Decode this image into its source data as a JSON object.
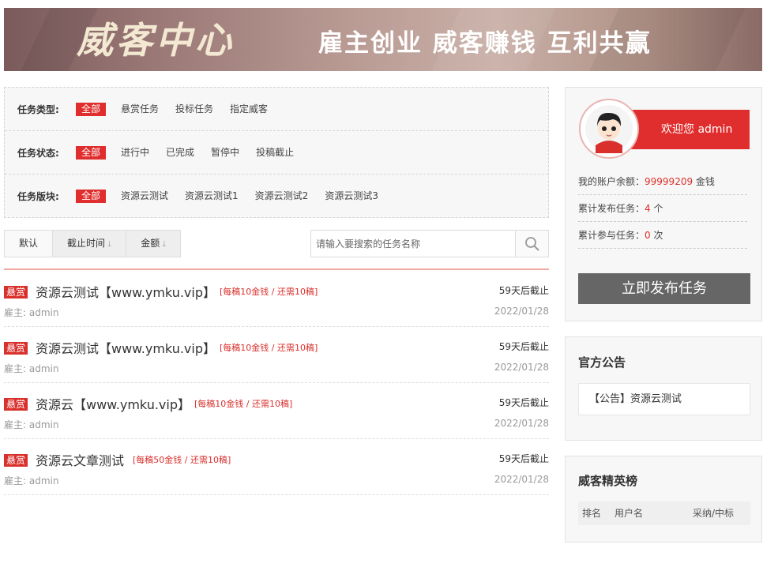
{
  "banner": {
    "title": "威客中心",
    "slogan": "雇主创业 威客赚钱 互利共赢"
  },
  "filters": [
    {
      "label": "任务类型:",
      "options": [
        "全部",
        "悬赏任务",
        "投标任务",
        "指定威客"
      ],
      "active": 0
    },
    {
      "label": "任务状态:",
      "options": [
        "全部",
        "进行中",
        "已完成",
        "暂停中",
        "投稿截止"
      ],
      "active": 0
    },
    {
      "label": "任务版块:",
      "options": [
        "全部",
        "资源云测试",
        "资源云测试1",
        "资源云测试2",
        "资源云测试3"
      ],
      "active": 0
    }
  ],
  "sort": {
    "default_label": "默认",
    "deadline_label": "截止时间",
    "amount_label": "金额"
  },
  "search": {
    "placeholder": "请输入要搜索的任务名称"
  },
  "tasks": [
    {
      "badge": "悬赏",
      "title": "资源云测试【www.ymku.vip】",
      "price": "[每稿10金钱 / 还需10稿]",
      "deadline": "59天后截止",
      "owner": "雇主: admin",
      "date": "2022/01/28"
    },
    {
      "badge": "悬赏",
      "title": "资源云测试【www.ymku.vip】",
      "price": "[每稿10金钱 / 还需10稿]",
      "deadline": "59天后截止",
      "owner": "雇主: admin",
      "date": "2022/01/28"
    },
    {
      "badge": "悬赏",
      "title": "资源云【www.ymku.vip】",
      "price": "[每稿10金钱 / 还需10稿]",
      "deadline": "59天后截止",
      "owner": "雇主: admin",
      "date": "2022/01/28"
    },
    {
      "badge": "悬赏",
      "title": "资源云文章测试",
      "price": "[每稿50金钱 / 还需10稿]",
      "deadline": "59天后截止",
      "owner": "雇主: admin",
      "date": "2022/01/28"
    }
  ],
  "user": {
    "welcome": "欢迎您 admin",
    "balance_label": "我的账户余额：",
    "balance_value": "99999209",
    "balance_unit": "金钱",
    "published_label": "累计发布任务：",
    "published_value": "4",
    "published_unit": "个",
    "joined_label": "累计参与任务：",
    "joined_value": "0",
    "joined_unit": "次",
    "publish_button": "立即发布任务"
  },
  "notice": {
    "title": "官方公告",
    "item": "【公告】资源云测试"
  },
  "ranking": {
    "title": "威客精英榜",
    "col_rank": "排名",
    "col_user": "用户名",
    "col_adopt": "采纳/中标"
  },
  "colors": {
    "accent": "#e02d2d",
    "price_red": "#d9302c",
    "publish_gray": "#666666"
  }
}
